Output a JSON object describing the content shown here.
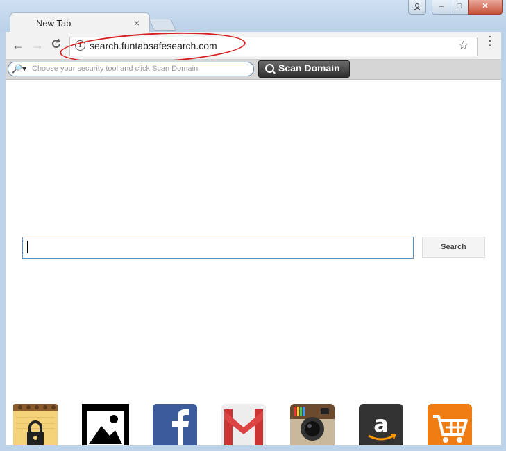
{
  "browser": {
    "tab_title": "New Tab",
    "tab_close_glyph": "×",
    "url": "search.funtabsafesearch.com",
    "nav": {
      "back_glyph": "←",
      "forward_glyph": "→",
      "reload_glyph": "C"
    },
    "star_glyph": "☆",
    "menu_glyph": "⋮",
    "window_buttons": {
      "user": "👤",
      "minimize": "–",
      "maximize": "□",
      "close": "✕"
    }
  },
  "extension_bar": {
    "search_placeholder": "Choose your security tool and click Scan Domain",
    "search_icon_glyph": "🔎▾",
    "scan_button_label": "Scan Domain"
  },
  "page": {
    "search_button_label": "Search",
    "search_value": ""
  },
  "shortcuts": [
    {
      "name": "notes-lock",
      "icon": "lock-notepad-icon"
    },
    {
      "name": "photos",
      "icon": "image-icon"
    },
    {
      "name": "facebook",
      "icon": "facebook-icon",
      "glyph": "f"
    },
    {
      "name": "gmail",
      "icon": "gmail-icon",
      "glyph": "M"
    },
    {
      "name": "instagram",
      "icon": "instagram-icon"
    },
    {
      "name": "amazon",
      "icon": "amazon-icon",
      "glyph": "a"
    },
    {
      "name": "shopping",
      "icon": "shopping-cart-icon"
    }
  ],
  "colors": {
    "highlight_ring": "#d62020",
    "search_border": "#5a8fc8",
    "facebook": "#3b5b9a",
    "shopping": "#f07d14"
  }
}
